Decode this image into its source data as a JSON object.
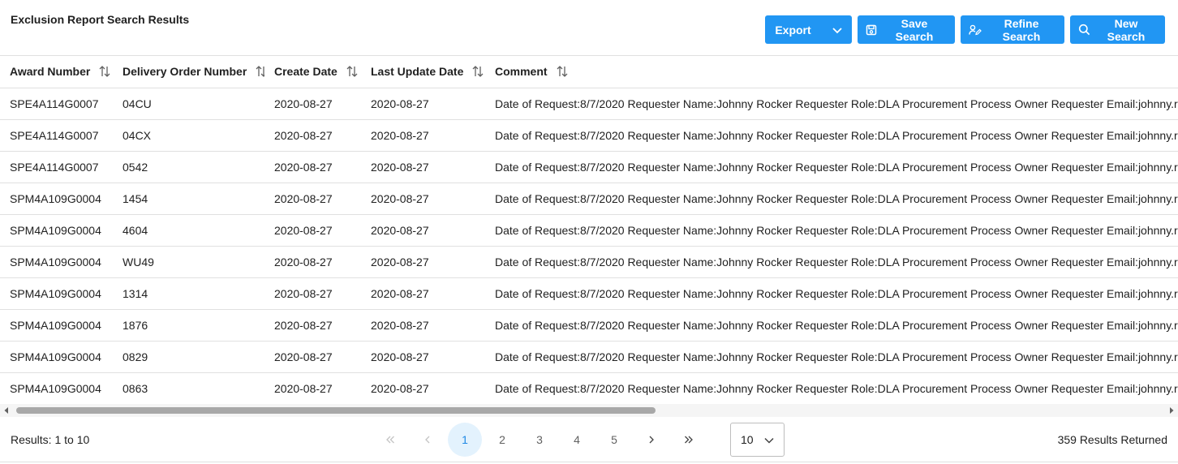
{
  "page": {
    "title": "Exclusion Report Search Results"
  },
  "toolbar": {
    "export_label": "Export",
    "save_label": "Save Search",
    "refine_label": "Refine Search",
    "new_label": "New Search"
  },
  "table": {
    "columns": [
      "Award Number",
      "Delivery Order Number",
      "Create Date",
      "Last Update Date",
      "Comment"
    ],
    "rows": [
      {
        "award": "SPE4A114G0007",
        "order": "04CU",
        "created": "2020-08-27",
        "updated": "2020-08-27",
        "comment": "Date of Request:8/7/2020 Requester Name:Johnny Rocker Requester Role:DLA Procurement Process Owner Requester Email:johnny.rocker"
      },
      {
        "award": "SPE4A114G0007",
        "order": "04CX",
        "created": "2020-08-27",
        "updated": "2020-08-27",
        "comment": "Date of Request:8/7/2020 Requester Name:Johnny Rocker Requester Role:DLA Procurement Process Owner Requester Email:johnny.rocker"
      },
      {
        "award": "SPE4A114G0007",
        "order": "0542",
        "created": "2020-08-27",
        "updated": "2020-08-27",
        "comment": "Date of Request:8/7/2020 Requester Name:Johnny Rocker Requester Role:DLA Procurement Process Owner Requester Email:johnny.rocker"
      },
      {
        "award": "SPM4A109G0004",
        "order": "1454",
        "created": "2020-08-27",
        "updated": "2020-08-27",
        "comment": "Date of Request:8/7/2020 Requester Name:Johnny Rocker Requester Role:DLA Procurement Process Owner Requester Email:johnny.rocker"
      },
      {
        "award": "SPM4A109G0004",
        "order": "4604",
        "created": "2020-08-27",
        "updated": "2020-08-27",
        "comment": "Date of Request:8/7/2020 Requester Name:Johnny Rocker Requester Role:DLA Procurement Process Owner Requester Email:johnny.rocker"
      },
      {
        "award": "SPM4A109G0004",
        "order": "WU49",
        "created": "2020-08-27",
        "updated": "2020-08-27",
        "comment": "Date of Request:8/7/2020 Requester Name:Johnny Rocker Requester Role:DLA Procurement Process Owner Requester Email:johnny.rocker"
      },
      {
        "award": "SPM4A109G0004",
        "order": "1314",
        "created": "2020-08-27",
        "updated": "2020-08-27",
        "comment": "Date of Request:8/7/2020 Requester Name:Johnny Rocker Requester Role:DLA Procurement Process Owner Requester Email:johnny.rocker"
      },
      {
        "award": "SPM4A109G0004",
        "order": "1876",
        "created": "2020-08-27",
        "updated": "2020-08-27",
        "comment": "Date of Request:8/7/2020 Requester Name:Johnny Rocker Requester Role:DLA Procurement Process Owner Requester Email:johnny.rocker"
      },
      {
        "award": "SPM4A109G0004",
        "order": "0829",
        "created": "2020-08-27",
        "updated": "2020-08-27",
        "comment": "Date of Request:8/7/2020 Requester Name:Johnny Rocker Requester Role:DLA Procurement Process Owner Requester Email:johnny.rocker"
      },
      {
        "award": "SPM4A109G0004",
        "order": "0863",
        "created": "2020-08-27",
        "updated": "2020-08-27",
        "comment": "Date of Request:8/7/2020 Requester Name:Johnny Rocker Requester Role:DLA Procurement Process Owner Requester Email:johnny.rocker"
      }
    ]
  },
  "footer": {
    "range_text": "Results: 1 to 10",
    "total_text": "359 Results Returned",
    "pages": [
      "1",
      "2",
      "3",
      "4",
      "5"
    ],
    "current_page": "1",
    "rows_per_page": "10"
  },
  "colors": {
    "accent": "#2196f3",
    "active_page_bg": "#e3f2fd",
    "active_page_text": "#1e88e5",
    "border": "#e0e0e0"
  },
  "icons": {
    "export_caret": "chevron-down-icon",
    "save": "floppy-disk-icon",
    "refine": "person-edit-icon",
    "new": "search-icon",
    "sort": "sort-arrows-icon"
  }
}
